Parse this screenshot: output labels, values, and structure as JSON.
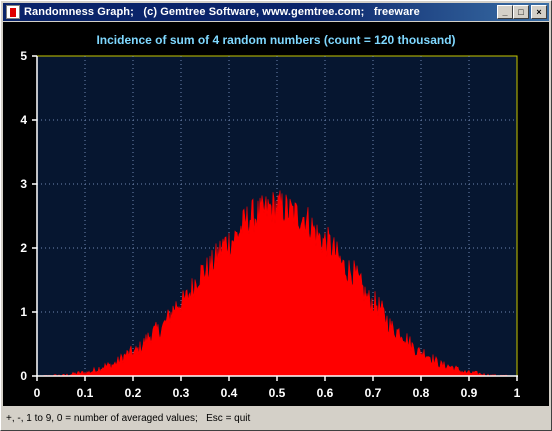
{
  "window": {
    "title": "Randomness Graph;   (c) Gemtree Software, www.gemtree.com;   freeware",
    "minimize_glyph": "_",
    "maximize_glyph": "□",
    "close_glyph": "×"
  },
  "colors": {
    "plot_background": "#061630",
    "grid": "#6f86b0",
    "axis": "#ffffff",
    "series_fill": "#ff0000",
    "title_text": "#7fd8ff",
    "frame_yellow": "#c8c800"
  },
  "chart_data": {
    "type": "area",
    "title": "Incidence of sum of 4 random numbers (count = 120 thousand)",
    "xlabel": "",
    "ylabel": "",
    "xlim": [
      0,
      1
    ],
    "ylim": [
      0,
      5
    ],
    "x_ticks": [
      "0",
      "0.1",
      "0.2",
      "0.3",
      "0.4",
      "0.5",
      "0.6",
      "0.7",
      "0.8",
      "0.9",
      "1"
    ],
    "y_ticks": [
      "0",
      "1",
      "2",
      "3",
      "4",
      "5"
    ],
    "grid": true,
    "series": [
      {
        "x": [
          0.0,
          0.05,
          0.1,
          0.15,
          0.2,
          0.25,
          0.3,
          0.35,
          0.4,
          0.45,
          0.5,
          0.55,
          0.6,
          0.65,
          0.7,
          0.75,
          0.8,
          0.85,
          0.9,
          0.95,
          1.0
        ],
        "values": [
          0.0,
          0.01,
          0.05,
          0.16,
          0.37,
          0.7,
          1.15,
          1.65,
          2.1,
          2.5,
          2.65,
          2.5,
          2.1,
          1.65,
          1.15,
          0.7,
          0.37,
          0.16,
          0.05,
          0.01,
          0.0
        ]
      }
    ]
  },
  "status": {
    "text": "+, -, 1 to 9, 0 = number of averaged values;   Esc = quit"
  }
}
